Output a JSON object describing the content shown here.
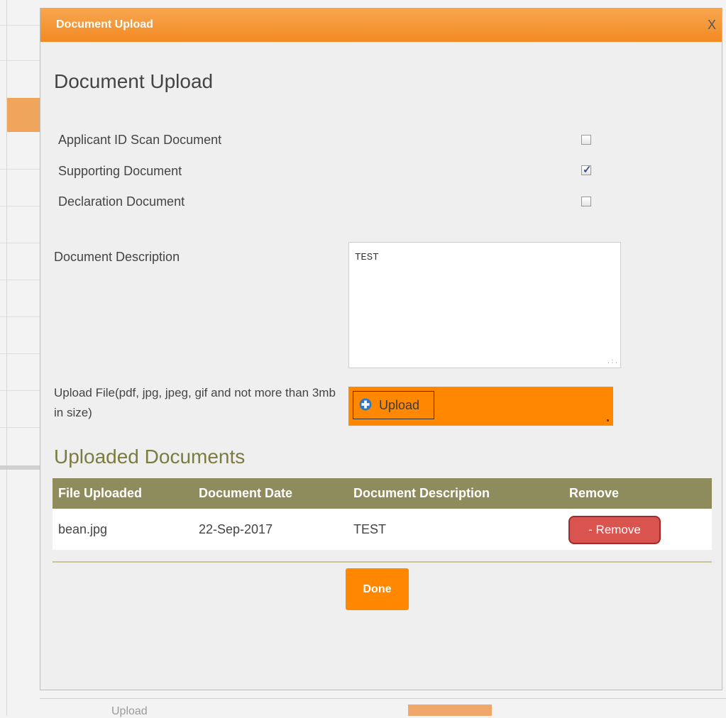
{
  "background": {
    "partial_text": "Upload"
  },
  "modal": {
    "title": "Document Upload",
    "close_label": "X",
    "heading": "Document Upload",
    "checkboxes": [
      {
        "label": "Applicant ID Scan Document",
        "checked": false
      },
      {
        "label": "Supporting Document",
        "checked": true
      },
      {
        "label": "Declaration Document",
        "checked": false
      }
    ],
    "description_label": "Document Description",
    "description_value": "TEST",
    "upload_label": "Upload File(pdf, jpg, jpeg, gif and not more than 3mb in size)",
    "upload_button": "Upload",
    "uploaded_title": "Uploaded Documents",
    "table": {
      "headers": [
        "File Uploaded",
        "Document Date",
        "Document Description",
        "Remove"
      ],
      "rows": [
        {
          "file": "bean.jpg",
          "date": "22-Sep-2017",
          "description": "TEST",
          "remove": "- Remove"
        }
      ]
    },
    "done_button": "Done"
  },
  "colors": {
    "titlebar": "#f28a22",
    "accent_orange": "#ff8800",
    "table_header": "#8e8b5c",
    "heading_olive": "#7a7d3f",
    "remove_red": "#d9534f"
  }
}
